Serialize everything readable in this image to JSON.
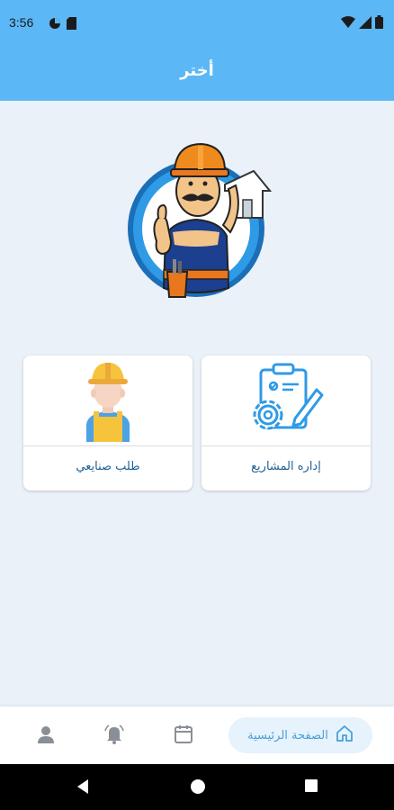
{
  "status_bar": {
    "time": "3:56",
    "icons": [
      "data-saver-icon",
      "sim-card-icon",
      "wifi-icon",
      "signal-icon",
      "battery-icon"
    ]
  },
  "app_bar": {
    "title": "أختر"
  },
  "options": [
    {
      "label": "إداره المشاريع",
      "icon": "project-management-icon"
    },
    {
      "label": "طلب صنايعي",
      "icon": "worker-icon"
    }
  ],
  "bottom_nav": {
    "home_label": "الصفحة الرئيسية",
    "items": [
      "home-icon",
      "calendar-icon",
      "notifications-icon",
      "profile-icon"
    ]
  },
  "colors": {
    "primary": "#5cb7f7",
    "background": "#eaf1f8",
    "label": "#1f5f94",
    "home_pill": "#e6f2fc"
  }
}
